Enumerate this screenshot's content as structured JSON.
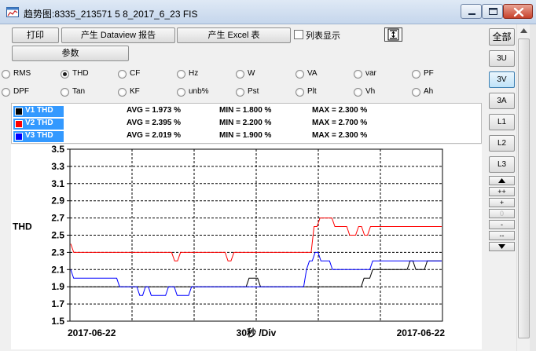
{
  "window": {
    "title": "趋势图:8335_213571 5 8_2017_6_23 FIS",
    "icons": {
      "app": "chart-window-icon",
      "minimize": "minimize-icon",
      "maximize": "maximize-icon",
      "close": "close-icon"
    }
  },
  "toolbar": {
    "print_label": "打印",
    "dataview_label": "产生 Dataview 报告",
    "excel_label": "产生 Excel 表",
    "params_label": "参数",
    "list_display_label": "列表显示",
    "list_display_checked": false,
    "scale_icon": "fit-vertical-icon"
  },
  "measurements": {
    "row1": [
      {
        "label": "RMS",
        "selected": false
      },
      {
        "label": "THD",
        "selected": true
      },
      {
        "label": "CF",
        "selected": false
      },
      {
        "label": "Hz",
        "selected": false
      },
      {
        "label": "W",
        "selected": false
      },
      {
        "label": "VA",
        "selected": false
      },
      {
        "label": "var",
        "selected": false
      },
      {
        "label": "PF",
        "selected": false
      }
    ],
    "row2": [
      {
        "label": "DPF",
        "selected": false
      },
      {
        "label": "Tan",
        "selected": false
      },
      {
        "label": "KF",
        "selected": false
      },
      {
        "label": "unb%",
        "selected": false
      },
      {
        "label": "Pst",
        "selected": false
      },
      {
        "label": "Plt",
        "selected": false
      },
      {
        "label": "Vh",
        "selected": false
      },
      {
        "label": "Ah",
        "selected": false
      }
    ]
  },
  "legend": [
    {
      "name": "V1 THD",
      "color": "#000000",
      "avg": "AVG = 1.973 %",
      "min": "MIN = 1.800 %",
      "max": "MAX = 2.300 %"
    },
    {
      "name": "V2 THD",
      "color": "#ff0000",
      "avg": "AVG = 2.395 %",
      "min": "MIN = 2.200 %",
      "max": "MAX = 2.700 %"
    },
    {
      "name": "V3 THD",
      "color": "#0000ff",
      "avg": "AVG = 2.019 %",
      "min": "MIN = 1.900 %",
      "max": "MAX = 2.300 %"
    }
  ],
  "side_buttons": {
    "all": "全部",
    "u3": "3U",
    "v3": "3V",
    "a3": "3A",
    "l1": "L1",
    "l2": "L2",
    "l3": "L3",
    "active": "3V",
    "scroll_up_icon": "triangle-up-icon",
    "zoom_in_more": "++",
    "zoom_in": "+",
    "zoom_level": "0",
    "zoom_out": "-",
    "zoom_out_more": "--",
    "scroll_down_icon": "triangle-down-icon"
  },
  "chart_data": {
    "type": "line",
    "ylabel": "THD",
    "ylim": [
      1.5,
      3.5
    ],
    "yticks": [
      "3.5",
      "3.3",
      "3.1",
      "2.9",
      "2.7",
      "2.5",
      "2.3",
      "2.1",
      "1.9",
      "1.7",
      "1.5"
    ],
    "x_start_label": "2017-06-22",
    "x_end_label": "2017-06-22",
    "x_division_label": "30秒 /Div",
    "divisions": 6,
    "grid": true,
    "series": [
      {
        "name": "V1 THD",
        "color": "#000000",
        "values": [
          1.9,
          1.9,
          1.9,
          1.9,
          1.9,
          1.9,
          1.9,
          1.9,
          1.9,
          1.9,
          1.9,
          1.9,
          1.9,
          1.9,
          1.9,
          1.9,
          1.9,
          1.9,
          1.9,
          1.9,
          1.9,
          1.9,
          1.9,
          1.9,
          1.9,
          1.9,
          1.9,
          1.9,
          1.9,
          1.9,
          1.9,
          1.9,
          1.9,
          1.9,
          1.9,
          1.9,
          1.9,
          1.9,
          1.9,
          1.9,
          1.9,
          1.9,
          1.9,
          1.9,
          1.9,
          1.9,
          1.9,
          1.9,
          1.9,
          1.9,
          1.9,
          1.9,
          1.9,
          1.9,
          1.9,
          1.9,
          1.9,
          1.9,
          1.9,
          1.9,
          1.9,
          1.9,
          2.0,
          2.0,
          2.0,
          2.0,
          1.9,
          1.9,
          1.9,
          1.9,
          1.9,
          1.9,
          1.9,
          1.9,
          1.9,
          1.9,
          1.9,
          1.9,
          1.9,
          1.9,
          1.9,
          1.9,
          1.9,
          1.9,
          1.9,
          1.9,
          1.9,
          1.9,
          1.9,
          1.9,
          1.9,
          1.9,
          1.9,
          1.9,
          1.9,
          1.9,
          1.9,
          1.9,
          1.9,
          1.9,
          1.9,
          1.9,
          2.0,
          2.0,
          2.0,
          2.1,
          2.1,
          2.1,
          2.1,
          2.1,
          2.1,
          2.1,
          2.1,
          2.1,
          2.1,
          2.1,
          2.1,
          2.1,
          2.2,
          2.2,
          2.1,
          2.1,
          2.1,
          2.1,
          2.2,
          2.2,
          2.2,
          2.2,
          2.2,
          2.2
        ]
      },
      {
        "name": "V2 THD",
        "color": "#ff0000",
        "values": [
          2.4,
          2.3,
          2.3,
          2.3,
          2.3,
          2.3,
          2.3,
          2.3,
          2.3,
          2.3,
          2.3,
          2.3,
          2.3,
          2.3,
          2.3,
          2.3,
          2.3,
          2.3,
          2.3,
          2.3,
          2.3,
          2.3,
          2.3,
          2.3,
          2.3,
          2.3,
          2.3,
          2.3,
          2.3,
          2.3,
          2.3,
          2.3,
          2.3,
          2.3,
          2.3,
          2.2,
          2.2,
          2.3,
          2.3,
          2.3,
          2.3,
          2.3,
          2.3,
          2.3,
          2.3,
          2.3,
          2.3,
          2.3,
          2.3,
          2.3,
          2.3,
          2.3,
          2.3,
          2.2,
          2.2,
          2.3,
          2.3,
          2.3,
          2.3,
          2.3,
          2.3,
          2.3,
          2.3,
          2.3,
          2.3,
          2.3,
          2.3,
          2.3,
          2.3,
          2.3,
          2.3,
          2.3,
          2.3,
          2.3,
          2.3,
          2.3,
          2.3,
          2.3,
          2.3,
          2.3,
          2.3,
          2.3,
          2.6,
          2.6,
          2.7,
          2.7,
          2.7,
          2.7,
          2.7,
          2.6,
          2.6,
          2.6,
          2.6,
          2.6,
          2.5,
          2.5,
          2.5,
          2.6,
          2.6,
          2.5,
          2.5,
          2.6,
          2.6,
          2.6,
          2.6,
          2.6,
          2.6,
          2.6,
          2.6,
          2.6,
          2.6,
          2.6,
          2.6,
          2.6,
          2.6,
          2.6,
          2.6,
          2.6,
          2.6,
          2.6,
          2.6,
          2.6,
          2.6,
          2.6,
          2.6,
          2.6
        ]
      },
      {
        "name": "V3 THD",
        "color": "#0000ff",
        "values": [
          2.1,
          2.0,
          2.0,
          2.0,
          2.0,
          2.0,
          2.0,
          2.0,
          2.0,
          2.0,
          2.0,
          2.0,
          2.0,
          2.0,
          2.0,
          2.0,
          2.0,
          1.9,
          1.9,
          1.9,
          1.9,
          1.9,
          1.9,
          1.9,
          1.8,
          1.8,
          1.9,
          1.9,
          1.8,
          1.8,
          1.8,
          1.8,
          1.8,
          1.8,
          1.9,
          1.9,
          1.9,
          1.8,
          1.8,
          1.8,
          1.8,
          1.8,
          1.9,
          1.9,
          1.9,
          1.9,
          1.9,
          1.9,
          1.9,
          1.9,
          1.9,
          1.9,
          1.9,
          1.9,
          1.9,
          1.9,
          1.9,
          1.9,
          1.9,
          1.9,
          1.9,
          1.9,
          1.9,
          1.9,
          1.9,
          1.9,
          1.9,
          1.9,
          1.9,
          1.9,
          1.9,
          1.9,
          1.9,
          1.9,
          1.9,
          1.9,
          1.9,
          1.9,
          1.9,
          1.9,
          1.9,
          1.9,
          2.1,
          2.2,
          2.2,
          2.3,
          2.3,
          2.2,
          2.2,
          2.2,
          2.2,
          2.1,
          2.1,
          2.1,
          2.1,
          2.1,
          2.1,
          2.1,
          2.1,
          2.1,
          2.1,
          2.1,
          2.1,
          2.1,
          2.1,
          2.2,
          2.2,
          2.2,
          2.2,
          2.2,
          2.2,
          2.2,
          2.2,
          2.2,
          2.2,
          2.2,
          2.2,
          2.2,
          2.2,
          2.2,
          2.2,
          2.2,
          2.2,
          2.2,
          2.2,
          2.2,
          2.2,
          2.2,
          2.2,
          2.2
        ]
      }
    ]
  }
}
